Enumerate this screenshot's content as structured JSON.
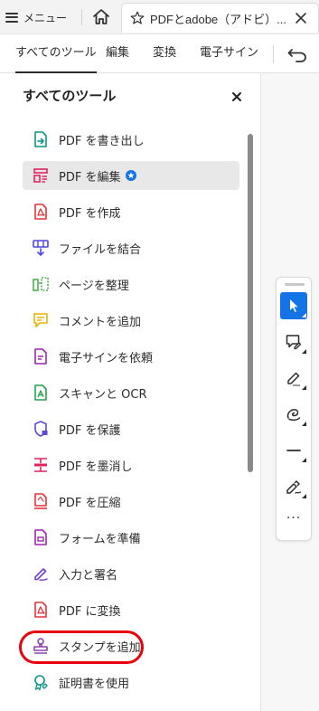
{
  "browser": {
    "menu_label": "メニュー",
    "tab_title": "PDFとadobe（アドビ）..."
  },
  "toolbar": {
    "items": [
      "すべてのツール",
      "編集",
      "変換",
      "電子サイン"
    ]
  },
  "panel": {
    "title": "すべてのツール",
    "tools": [
      {
        "label": "PDF を書き出し",
        "icon": "export-pdf-icon",
        "color": "#0d9488"
      },
      {
        "label": "PDF を編集",
        "icon": "edit-pdf-icon",
        "color": "#e0245e",
        "badge": "premium-star-icon"
      },
      {
        "label": "PDF を作成",
        "icon": "create-pdf-icon",
        "color": "#e0353b"
      },
      {
        "label": "ファイルを結合",
        "icon": "combine-files-icon",
        "color": "#4f46e5"
      },
      {
        "label": "ページを整理",
        "icon": "organize-pages-icon",
        "color": "#4caf50"
      },
      {
        "label": "コメントを追加",
        "icon": "add-comment-icon",
        "color": "#e8b400"
      },
      {
        "label": "電子サインを依頼",
        "icon": "request-esign-icon",
        "color": "#9c27b0"
      },
      {
        "label": "スキャンと OCR",
        "icon": "scan-ocr-icon",
        "color": "#22a34a"
      },
      {
        "label": "PDF を保護",
        "icon": "protect-pdf-icon",
        "color": "#5b4bd6"
      },
      {
        "label": "PDF を墨消し",
        "icon": "redact-pdf-icon",
        "color": "#e0245e"
      },
      {
        "label": "PDF を圧縮",
        "icon": "compress-pdf-icon",
        "color": "#e0353b"
      },
      {
        "label": "フォームを準備",
        "icon": "prepare-form-icon",
        "color": "#9c27b0"
      },
      {
        "label": "入力と署名",
        "icon": "fill-sign-icon",
        "color": "#6b3fd6"
      },
      {
        "label": "PDF に変換",
        "icon": "convert-to-pdf-icon",
        "color": "#e0353b"
      },
      {
        "label": "スタンプを追加",
        "icon": "add-stamp-icon",
        "color": "#8e44ad"
      },
      {
        "label": "証明書を使用",
        "icon": "use-certificate-icon",
        "color": "#0d9488"
      }
    ]
  },
  "palette": {
    "tools": [
      "select-pointer-icon",
      "add-comment-icon",
      "highlight-icon",
      "draw-icon",
      "line-icon",
      "sign-icon"
    ],
    "more_label": "···"
  },
  "colors": {
    "accent": "#1473e6",
    "highlight_circle": "#e8000d"
  }
}
